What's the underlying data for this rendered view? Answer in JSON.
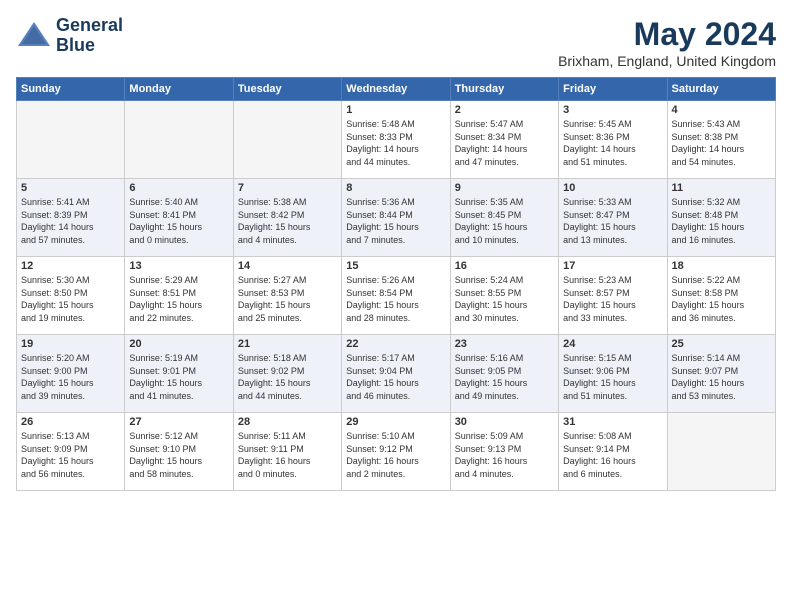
{
  "logo": {
    "line1": "General",
    "line2": "Blue"
  },
  "title": "May 2024",
  "location": "Brixham, England, United Kingdom",
  "days_of_week": [
    "Sunday",
    "Monday",
    "Tuesday",
    "Wednesday",
    "Thursday",
    "Friday",
    "Saturday"
  ],
  "weeks": [
    [
      {
        "day": "",
        "info": ""
      },
      {
        "day": "",
        "info": ""
      },
      {
        "day": "",
        "info": ""
      },
      {
        "day": "1",
        "info": "Sunrise: 5:48 AM\nSunset: 8:33 PM\nDaylight: 14 hours\nand 44 minutes."
      },
      {
        "day": "2",
        "info": "Sunrise: 5:47 AM\nSunset: 8:34 PM\nDaylight: 14 hours\nand 47 minutes."
      },
      {
        "day": "3",
        "info": "Sunrise: 5:45 AM\nSunset: 8:36 PM\nDaylight: 14 hours\nand 51 minutes."
      },
      {
        "day": "4",
        "info": "Sunrise: 5:43 AM\nSunset: 8:38 PM\nDaylight: 14 hours\nand 54 minutes."
      }
    ],
    [
      {
        "day": "5",
        "info": "Sunrise: 5:41 AM\nSunset: 8:39 PM\nDaylight: 14 hours\nand 57 minutes."
      },
      {
        "day": "6",
        "info": "Sunrise: 5:40 AM\nSunset: 8:41 PM\nDaylight: 15 hours\nand 0 minutes."
      },
      {
        "day": "7",
        "info": "Sunrise: 5:38 AM\nSunset: 8:42 PM\nDaylight: 15 hours\nand 4 minutes."
      },
      {
        "day": "8",
        "info": "Sunrise: 5:36 AM\nSunset: 8:44 PM\nDaylight: 15 hours\nand 7 minutes."
      },
      {
        "day": "9",
        "info": "Sunrise: 5:35 AM\nSunset: 8:45 PM\nDaylight: 15 hours\nand 10 minutes."
      },
      {
        "day": "10",
        "info": "Sunrise: 5:33 AM\nSunset: 8:47 PM\nDaylight: 15 hours\nand 13 minutes."
      },
      {
        "day": "11",
        "info": "Sunrise: 5:32 AM\nSunset: 8:48 PM\nDaylight: 15 hours\nand 16 minutes."
      }
    ],
    [
      {
        "day": "12",
        "info": "Sunrise: 5:30 AM\nSunset: 8:50 PM\nDaylight: 15 hours\nand 19 minutes."
      },
      {
        "day": "13",
        "info": "Sunrise: 5:29 AM\nSunset: 8:51 PM\nDaylight: 15 hours\nand 22 minutes."
      },
      {
        "day": "14",
        "info": "Sunrise: 5:27 AM\nSunset: 8:53 PM\nDaylight: 15 hours\nand 25 minutes."
      },
      {
        "day": "15",
        "info": "Sunrise: 5:26 AM\nSunset: 8:54 PM\nDaylight: 15 hours\nand 28 minutes."
      },
      {
        "day": "16",
        "info": "Sunrise: 5:24 AM\nSunset: 8:55 PM\nDaylight: 15 hours\nand 30 minutes."
      },
      {
        "day": "17",
        "info": "Sunrise: 5:23 AM\nSunset: 8:57 PM\nDaylight: 15 hours\nand 33 minutes."
      },
      {
        "day": "18",
        "info": "Sunrise: 5:22 AM\nSunset: 8:58 PM\nDaylight: 15 hours\nand 36 minutes."
      }
    ],
    [
      {
        "day": "19",
        "info": "Sunrise: 5:20 AM\nSunset: 9:00 PM\nDaylight: 15 hours\nand 39 minutes."
      },
      {
        "day": "20",
        "info": "Sunrise: 5:19 AM\nSunset: 9:01 PM\nDaylight: 15 hours\nand 41 minutes."
      },
      {
        "day": "21",
        "info": "Sunrise: 5:18 AM\nSunset: 9:02 PM\nDaylight: 15 hours\nand 44 minutes."
      },
      {
        "day": "22",
        "info": "Sunrise: 5:17 AM\nSunset: 9:04 PM\nDaylight: 15 hours\nand 46 minutes."
      },
      {
        "day": "23",
        "info": "Sunrise: 5:16 AM\nSunset: 9:05 PM\nDaylight: 15 hours\nand 49 minutes."
      },
      {
        "day": "24",
        "info": "Sunrise: 5:15 AM\nSunset: 9:06 PM\nDaylight: 15 hours\nand 51 minutes."
      },
      {
        "day": "25",
        "info": "Sunrise: 5:14 AM\nSunset: 9:07 PM\nDaylight: 15 hours\nand 53 minutes."
      }
    ],
    [
      {
        "day": "26",
        "info": "Sunrise: 5:13 AM\nSunset: 9:09 PM\nDaylight: 15 hours\nand 56 minutes."
      },
      {
        "day": "27",
        "info": "Sunrise: 5:12 AM\nSunset: 9:10 PM\nDaylight: 15 hours\nand 58 minutes."
      },
      {
        "day": "28",
        "info": "Sunrise: 5:11 AM\nSunset: 9:11 PM\nDaylight: 16 hours\nand 0 minutes."
      },
      {
        "day": "29",
        "info": "Sunrise: 5:10 AM\nSunset: 9:12 PM\nDaylight: 16 hours\nand 2 minutes."
      },
      {
        "day": "30",
        "info": "Sunrise: 5:09 AM\nSunset: 9:13 PM\nDaylight: 16 hours\nand 4 minutes."
      },
      {
        "day": "31",
        "info": "Sunrise: 5:08 AM\nSunset: 9:14 PM\nDaylight: 16 hours\nand 6 minutes."
      },
      {
        "day": "",
        "info": ""
      }
    ]
  ]
}
